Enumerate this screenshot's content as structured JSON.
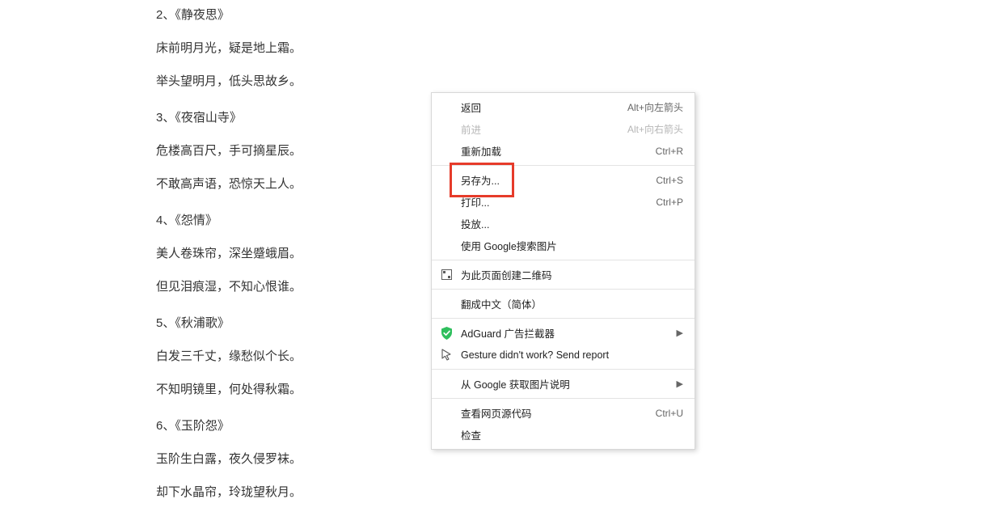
{
  "article": {
    "blocks": [
      {
        "type": "title",
        "text": "2、《静夜思》"
      },
      {
        "type": "line",
        "text": "床前明月光，疑是地上霜。"
      },
      {
        "type": "line",
        "text": "举头望明月，低头思故乡。"
      },
      {
        "type": "title",
        "text": "3、《夜宿山寺》"
      },
      {
        "type": "line",
        "text": "危楼高百尺，手可摘星辰。"
      },
      {
        "type": "line",
        "text": "不敢高声语，恐惊天上人。"
      },
      {
        "type": "title",
        "text": "4、《怨情》"
      },
      {
        "type": "line",
        "text": "美人卷珠帘，深坐蹙蛾眉。"
      },
      {
        "type": "line",
        "text": "但见泪痕湿，不知心恨谁。"
      },
      {
        "type": "title",
        "text": "5、《秋浦歌》"
      },
      {
        "type": "line",
        "text": "白发三千丈，缘愁似个长。"
      },
      {
        "type": "line",
        "text": "不知明镜里，何处得秋霜。"
      },
      {
        "type": "title",
        "text": "6、《玉阶怨》"
      },
      {
        "type": "line",
        "text": "玉阶生白露，夜久侵罗袜。"
      },
      {
        "type": "line",
        "text": "却下水晶帘，玲珑望秋月。"
      }
    ]
  },
  "context_menu": {
    "items": [
      {
        "id": "back",
        "label": "返回",
        "shortcut": "Alt+向左箭头",
        "disabled": false
      },
      {
        "id": "forward",
        "label": "前进",
        "shortcut": "Alt+向右箭头",
        "disabled": true
      },
      {
        "id": "reload",
        "label": "重新加载",
        "shortcut": "Ctrl+R",
        "disabled": false
      },
      {
        "id": "sep"
      },
      {
        "id": "save-as",
        "label": "另存为...",
        "shortcut": "Ctrl+S",
        "disabled": false
      },
      {
        "id": "print",
        "label": "打印...",
        "shortcut": "Ctrl+P",
        "disabled": false,
        "highlighted": true
      },
      {
        "id": "cast",
        "label": "投放...",
        "shortcut": "",
        "disabled": false
      },
      {
        "id": "search-img",
        "label": "使用 Google搜索图片",
        "shortcut": "",
        "disabled": false
      },
      {
        "id": "sep"
      },
      {
        "id": "create-qr",
        "label": "为此页面创建二维码",
        "shortcut": "",
        "icon": "qr-icon",
        "disabled": false
      },
      {
        "id": "sep"
      },
      {
        "id": "translate",
        "label": "翻成中文（简体）",
        "shortcut": "",
        "disabled": false
      },
      {
        "id": "sep"
      },
      {
        "id": "adguard",
        "label": "AdGuard 广告拦截器",
        "shortcut": "",
        "icon": "shield-icon",
        "submenu": true,
        "disabled": false
      },
      {
        "id": "gesture",
        "label": "Gesture didn't work? Send report",
        "shortcut": "",
        "icon": "cursor-icon",
        "disabled": false
      },
      {
        "id": "sep"
      },
      {
        "id": "google-desc",
        "label": "从 Google 获取图片说明",
        "shortcut": "",
        "submenu": true,
        "disabled": false
      },
      {
        "id": "sep"
      },
      {
        "id": "view-source",
        "label": "查看网页源代码",
        "shortcut": "Ctrl+U",
        "disabled": false
      },
      {
        "id": "inspect",
        "label": "检查",
        "shortcut": "",
        "disabled": false
      }
    ]
  }
}
